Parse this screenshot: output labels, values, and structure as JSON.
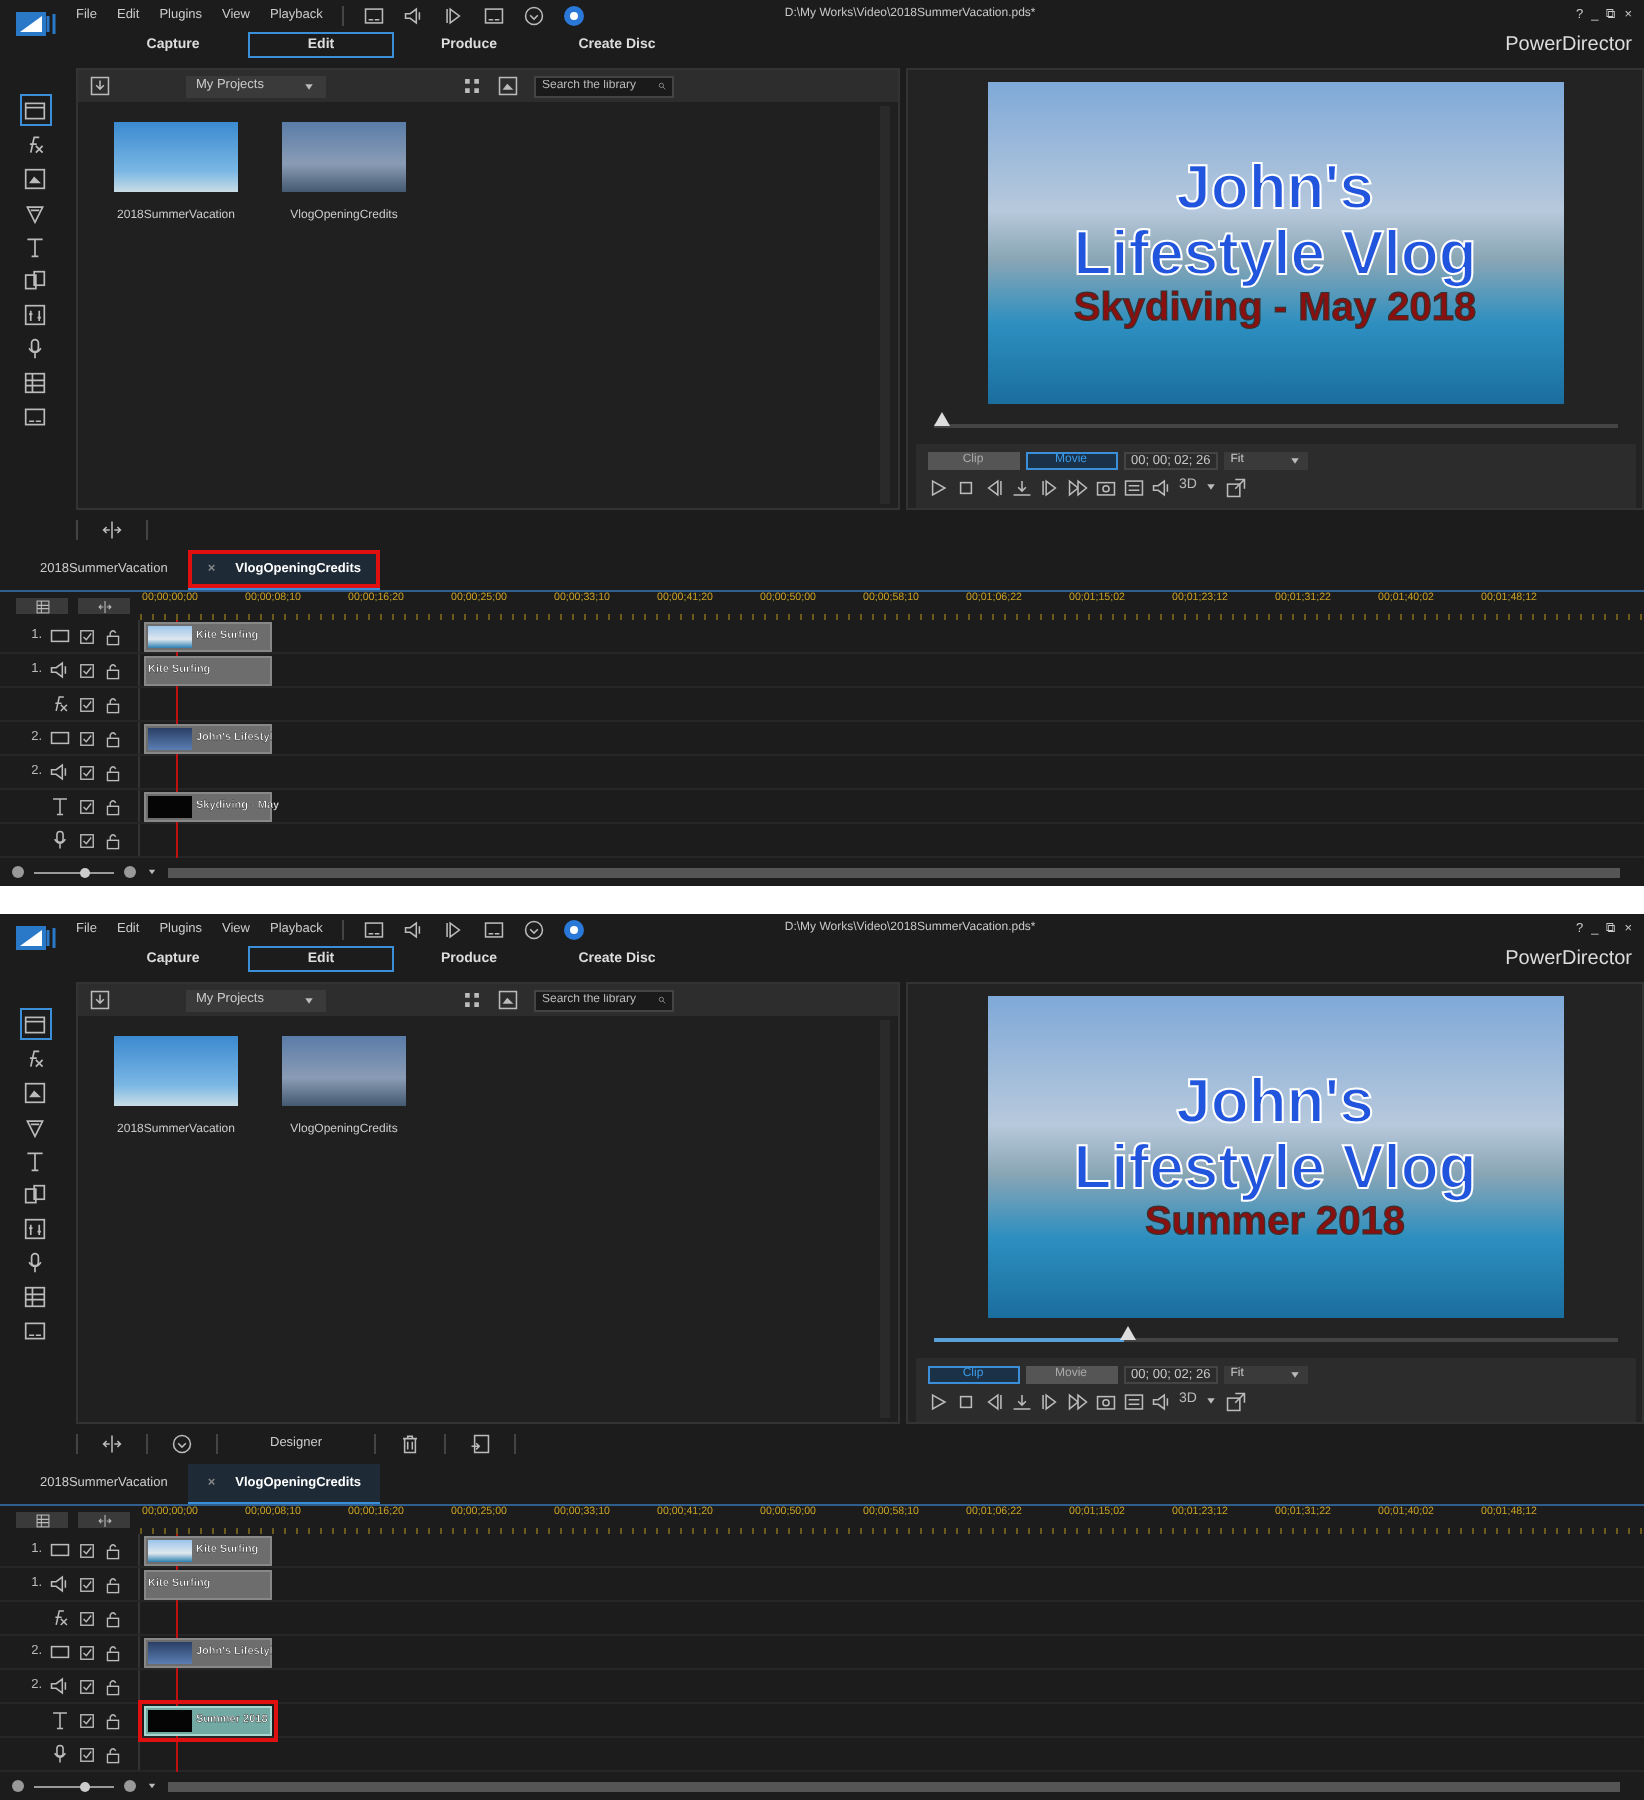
{
  "screens": [
    {
      "menu": [
        "File",
        "Edit",
        "Plugins",
        "View",
        "Playback"
      ],
      "file_path": "D:\\My Works\\Video\\2018SummerVacation.pds*",
      "window_controls": [
        "?",
        "_",
        "⧉",
        "×"
      ],
      "app_name": "PowerDirector",
      "mode_tabs": [
        {
          "label": "Capture",
          "selected": false
        },
        {
          "label": "Edit",
          "selected": true
        },
        {
          "label": "Produce",
          "selected": false
        },
        {
          "label": "Create Disc",
          "selected": false
        }
      ],
      "sidebar": [
        {
          "selected": true
        },
        {
          "selected": false
        },
        {
          "selected": false
        },
        {
          "selected": false
        },
        {
          "selected": false
        },
        {
          "selected": false
        },
        {
          "selected": false
        },
        {
          "selected": false
        },
        {
          "selected": false
        },
        {
          "selected": false
        }
      ],
      "library": {
        "dropdown": "My Projects",
        "search": {
          "placeholder": "Search the library"
        },
        "items": [
          {
            "label": "2018SummerVacation",
            "kind": "sea"
          },
          {
            "label": "VlogOpeningCredits",
            "kind": "title"
          }
        ]
      },
      "preview": {
        "lines": [
          "John's",
          "Lifestyle Vlog",
          "Skydiving - May 2018"
        ],
        "level": 0,
        "modes": [
          {
            "label": "Clip",
            "selected": false
          },
          {
            "label": "Movie",
            "selected": true
          }
        ],
        "timecode": "00; 00; 02; 26",
        "zoom": "Fit",
        "mode_3d": "3D"
      },
      "toolbar": [
        {
          "kind": "split"
        }
      ],
      "timeline_tabs": [
        {
          "label": "2018SummerVacation",
          "selected": false,
          "highlighted": false
        },
        {
          "label": "VlogOpeningCredits",
          "selected": true,
          "highlighted": true,
          "close": "×"
        }
      ],
      "ruler": [
        "00;00;00;00",
        "00;00;08;10",
        "00;00;16;20",
        "00;00;25;00",
        "00;00;33;10",
        "00;00;41;20",
        "00;00;50;00",
        "00;00;58;10",
        "00;01;06;22",
        "00;01;15;02",
        "00;01;23;12",
        "00;01;31;22",
        "00;01;40;02",
        "00;01;48;12"
      ],
      "tracks": [
        {
          "kind": "video",
          "number": "1.",
          "clip": {
            "kind": "video",
            "label": "Kite Surfing",
            "selected": false,
            "highlighted": false
          }
        },
        {
          "kind": "audio",
          "number": "1.",
          "clip": {
            "kind": "audio",
            "label": "Kite Surfing",
            "selected": false,
            "highlighted": false
          }
        },
        {
          "kind": "fx"
        },
        {
          "kind": "video",
          "number": "2.",
          "clip": {
            "kind": "titlevideo",
            "label": "John's Lifestyl",
            "selected": false,
            "highlighted": false
          }
        },
        {
          "kind": "audio",
          "number": "2."
        },
        {
          "kind": "title",
          "clip": {
            "kind": "title",
            "label": "Skydiving - May",
            "selected": false,
            "highlighted": false
          }
        },
        {
          "kind": "voice"
        }
      ],
      "zoom_slider": {
        "level": 0.65
      }
    },
    {
      "menu": [
        "File",
        "Edit",
        "Plugins",
        "View",
        "Playback"
      ],
      "file_path": "D:\\My Works\\Video\\2018SummerVacation.pds*",
      "window_controls": [
        "?",
        "_",
        "⧉",
        "×"
      ],
      "app_name": "PowerDirector",
      "mode_tabs": [
        {
          "label": "Capture",
          "selected": false
        },
        {
          "label": "Edit",
          "selected": true
        },
        {
          "label": "Produce",
          "selected": false
        },
        {
          "label": "Create Disc",
          "selected": false
        }
      ],
      "sidebar": [
        {
          "selected": true
        },
        {
          "selected": false
        },
        {
          "selected": false
        },
        {
          "selected": false
        },
        {
          "selected": false
        },
        {
          "selected": false
        },
        {
          "selected": false
        },
        {
          "selected": false
        },
        {
          "selected": false
        },
        {
          "selected": false
        }
      ],
      "library": {
        "dropdown": "My Projects",
        "search": {
          "placeholder": "Search the library"
        },
        "items": [
          {
            "label": "2018SummerVacation",
            "kind": "sea"
          },
          {
            "label": "VlogOpeningCredits",
            "kind": "title"
          }
        ]
      },
      "preview": {
        "lines": [
          "John's",
          "Lifestyle Vlog",
          "Summer 2018"
        ],
        "level": 0.28,
        "modes": [
          {
            "label": "Clip",
            "selected": true
          },
          {
            "label": "Movie",
            "selected": false
          }
        ],
        "timecode": "00; 00; 02; 26",
        "zoom": "Fit",
        "mode_3d": "3D"
      },
      "toolbar": [
        {
          "kind": "split"
        },
        {
          "kind": "timer"
        },
        {
          "kind": "designer",
          "label": "Designer"
        },
        {
          "kind": "trash"
        },
        {
          "kind": "export"
        }
      ],
      "timeline_tabs": [
        {
          "label": "2018SummerVacation",
          "selected": false,
          "highlighted": false
        },
        {
          "label": "VlogOpeningCredits",
          "selected": true,
          "highlighted": false,
          "close": "×"
        }
      ],
      "ruler": [
        "00;00;00;00",
        "00;00;08;10",
        "00;00;16;20",
        "00;00;25;00",
        "00;00;33;10",
        "00;00;41;20",
        "00;00;50;00",
        "00;00;58;10",
        "00;01;06;22",
        "00;01;15;02",
        "00;01;23;12",
        "00;01;31;22",
        "00;01;40;02",
        "00;01;48;12"
      ],
      "tracks": [
        {
          "kind": "video",
          "number": "1.",
          "clip": {
            "kind": "video",
            "label": "Kite Surfing",
            "selected": false,
            "highlighted": false
          }
        },
        {
          "kind": "audio",
          "number": "1.",
          "clip": {
            "kind": "audio",
            "label": "Kite Surfing",
            "selected": false,
            "highlighted": false
          }
        },
        {
          "kind": "fx"
        },
        {
          "kind": "video",
          "number": "2.",
          "clip": {
            "kind": "titlevideo",
            "label": "John's Lifestyl",
            "selected": false,
            "highlighted": false
          }
        },
        {
          "kind": "audio",
          "number": "2."
        },
        {
          "kind": "title",
          "clip": {
            "kind": "title",
            "label": "Summer 2018",
            "selected": true,
            "highlighted": true
          }
        },
        {
          "kind": "voice"
        }
      ],
      "zoom_slider": {
        "level": 0.65
      }
    }
  ]
}
